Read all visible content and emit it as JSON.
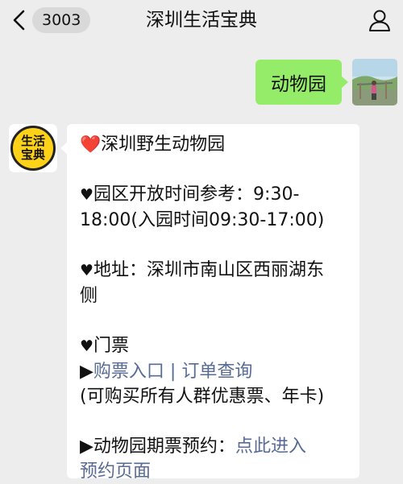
{
  "nav": {
    "back_count": "3003",
    "title": "深圳生活宝典"
  },
  "outgoing": {
    "text": "动物园"
  },
  "avatar": {
    "line1": "生活",
    "line2": "宝典"
  },
  "message": {
    "heading": "深圳野生动物园",
    "hours_line1": "园区开放时间参考：9:30-",
    "hours_line2": "18:00(入园时间09:30-17:00)",
    "address_line1": "地址：深圳市南山区西丽湖东",
    "address_line2": "侧",
    "tickets_label": "门票",
    "buy_link": "购票入口",
    "separator": " | ",
    "order_link": "订单查询",
    "ticket_note": "(可购买所有人群优惠票、年卡)",
    "pass_label": "动物园期票预约：",
    "pass_link_1": "点此进入",
    "pass_link_2": "预约页面"
  },
  "colors": {
    "outgoing_bubble": "#95ec69",
    "link": "#576b95",
    "background": "#ededed",
    "heart": "#e0242b"
  }
}
